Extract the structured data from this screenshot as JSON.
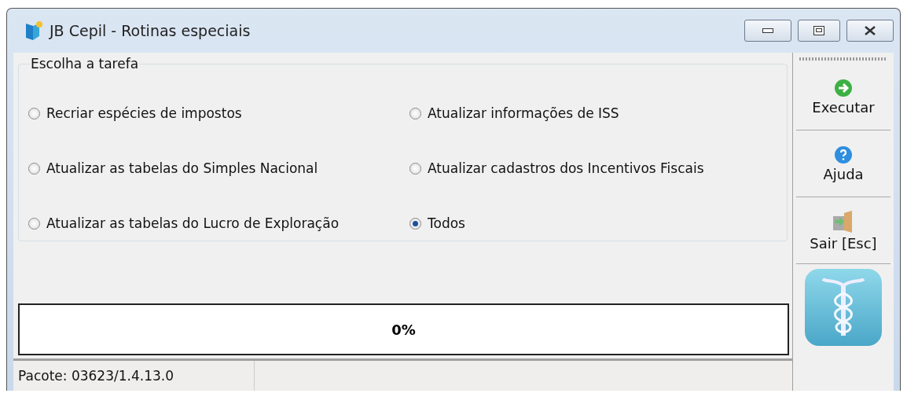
{
  "window": {
    "title": "JB Cepil - Rotinas especiais"
  },
  "task_group": {
    "title": "Escolha a tarefa",
    "options": [
      {
        "label": "Recriar espécies de impostos",
        "selected": false
      },
      {
        "label": "Atualizar informações de ISS",
        "selected": false
      },
      {
        "label": "Atualizar as tabelas do Simples Nacional",
        "selected": false
      },
      {
        "label": "Atualizar cadastros dos Incentivos Fiscais",
        "selected": false
      },
      {
        "label": "Atualizar as tabelas do Lucro de Exploração",
        "selected": false
      },
      {
        "label": "Todos",
        "selected": true
      }
    ]
  },
  "progress": {
    "reading": "0%"
  },
  "toolbar": [
    {
      "kind": "run",
      "label": "Executar"
    },
    {
      "kind": "help",
      "label": "Ajuda"
    },
    {
      "kind": "exit",
      "label": "Sair [Esc]"
    }
  ],
  "status_bar": {
    "text": "Pacote: 03623/1.4.13.0"
  }
}
